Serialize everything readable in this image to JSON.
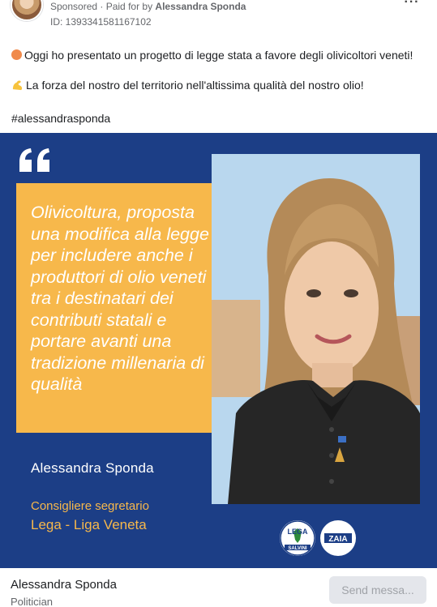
{
  "header": {
    "sponsored_label": "Sponsored",
    "paid_prefix": " · Paid for by ",
    "payer": "Alessandra Sponda",
    "ad_id": "ID: 1393341581167102",
    "more_label": "···"
  },
  "post": {
    "line1": "Oggi ho presentato un progetto di legge stata a favore degli olivicoltori veneti!",
    "line2": "La forza del nostro del territorio nell'altissima qualità del nostro olio!",
    "hashtag": "#alessandrasponda"
  },
  "creative": {
    "quote": "Olivicoltura, proposta una modifica alla legge per includere anche i produttori di olio veneti tra i destinatari dei contributi statali e portare avanti una tradizione millenaria di qualità",
    "name": "Alessandra Sponda",
    "role": "Consigliere segretario",
    "party": "Lega - Liga Veneta",
    "logo_lega_text": "LEGA",
    "logo_lega_sub": "SALVINI",
    "logo_zaia_text": "ZAIA",
    "colors": {
      "background": "#1c3e86",
      "accent": "#f7b84b"
    }
  },
  "footer": {
    "page_name": "Alessandra Sponda",
    "category": "Politician",
    "send_button": "Send messa..."
  }
}
